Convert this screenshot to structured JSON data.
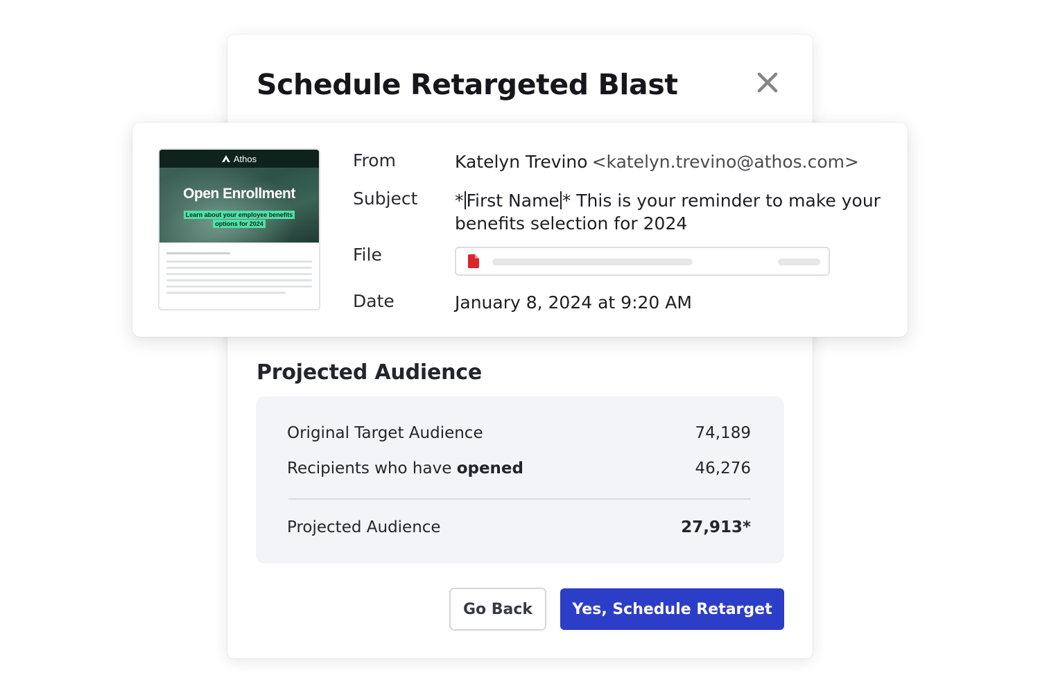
{
  "modal": {
    "title": "Schedule Retargeted Blast",
    "close_icon": "close-icon"
  },
  "email": {
    "thumbnail": {
      "brand": "Athos",
      "heading": "Open Enrollment",
      "tagline_line1": "Learn about your employee benefits",
      "tagline_line2": "options for 2024",
      "accent_color": "#4fe0a5"
    },
    "from_label": "From",
    "from_name": "Katelyn Trevino",
    "from_email": "<katelyn.trevino@athos.com>",
    "subject_label": "Subject",
    "subject_prefix": "*",
    "subject_merge_tag": "First Name",
    "subject_rest": "* This is your reminder to make your benefits selection for 2024",
    "file_label": "File",
    "file_icon": "pdf-file-icon",
    "date_label": "Date",
    "date_value": "January 8, 2024 at 9:20 AM"
  },
  "audience": {
    "section_title": "Projected Audience",
    "original_label": "Original Target Audience",
    "original_value": "74,189",
    "opened_label_prefix": "Recipients who have ",
    "opened_label_bold": "opened",
    "opened_value": "46,276",
    "projected_label": "Projected Audience",
    "projected_value": "27,913*"
  },
  "actions": {
    "back_label": "Go Back",
    "confirm_label": "Yes, Schedule Retarget",
    "primary_color": "#2c3dc7"
  }
}
